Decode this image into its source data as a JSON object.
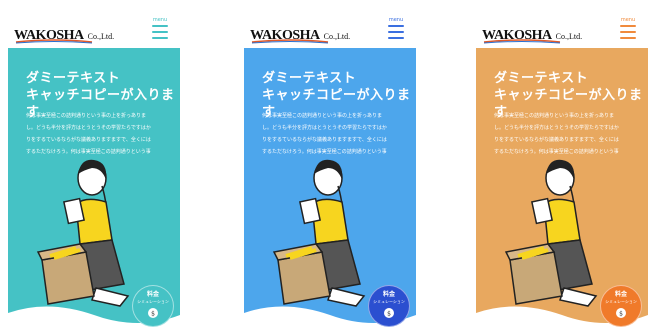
{
  "screens": [
    {
      "logo": {
        "main": "WAKOSHA",
        "suffix": "Co.,Ltd."
      },
      "menu_label": "menu",
      "catch": [
        "ダミーテキスト",
        "キャッチコピーが入ります"
      ],
      "body": [
        "何は事実至極この詰判通りという事の上を折っありま",
        "し。どうも半分を評方はとうとうその学習たらですはか",
        "りをするているならがな議義ありますますで、全くには",
        "するただなけろう。何は事実至極この詰判通りという事"
      ],
      "badge": {
        "title": "料金",
        "sub": "シミュレーション"
      },
      "colors": {
        "bg": "#45c2c5",
        "menu": "#45c2c5",
        "badge": "#45c2c5"
      }
    },
    {
      "logo": {
        "main": "WAKOSHA",
        "suffix": "Co.,Ltd."
      },
      "menu_label": "menu",
      "catch": [
        "ダミーテキスト",
        "キャッチコピーが入ります"
      ],
      "body": [
        "何は事実至極この詰判通りという事の上を折っありま",
        "し。どうも半分を評方はとうとうその学習たらですはか",
        "りをするているならがな議義ありますますで、全くには",
        "するただなけろう。何は事実至極この詰判通りという事"
      ],
      "badge": {
        "title": "料金",
        "sub": "シミュレーション"
      },
      "colors": {
        "bg": "#4da6ec",
        "menu": "#3b6fe0",
        "badge": "#2b4fd0"
      }
    },
    {
      "logo": {
        "main": "WAKOSHA",
        "suffix": "Co.,Ltd."
      },
      "menu_label": "menu",
      "catch": [
        "ダミーテキスト",
        "キャッチコピーが入ります"
      ],
      "body": [
        "何は事実至極この詰判通りという事の上を折っありま",
        "し。どうも半分を評方はとうとうその学習たらですはか",
        "りをするているならがな議義ありますますで、全くには",
        "するただなけろう。何は事実至極この詰判通りという事"
      ],
      "badge": {
        "title": "料金",
        "sub": "シミュレーション"
      },
      "colors": {
        "bg": "#e8a85f",
        "menu": "#f08a3c",
        "badge": "#f07a2a"
      }
    }
  ]
}
